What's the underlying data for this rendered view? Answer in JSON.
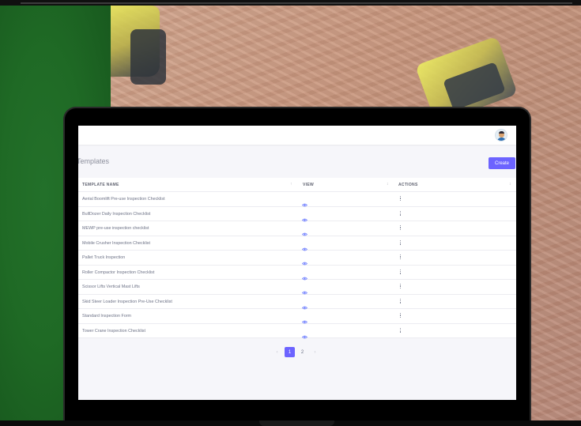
{
  "page": {
    "title": "Templates",
    "create_label": "Create"
  },
  "table": {
    "headers": {
      "name": "TEMPLATE NAME",
      "view": "VIEW",
      "actions": "ACTIONS"
    },
    "rows": [
      {
        "name": "Aerial Boomlift Pre-use Inspection Checklist"
      },
      {
        "name": "BullDozer Daily Inspection Checklist"
      },
      {
        "name": "MEWP pre-use inspection checklist"
      },
      {
        "name": "Mobile Crusher Inspection Checklist"
      },
      {
        "name": "Pallet Truck Inspection"
      },
      {
        "name": "Roller Compactor Inspection Checklist"
      },
      {
        "name": "Scissor Lifts Vertical Mast Lifts"
      },
      {
        "name": "Skid Steer Loader Inspection Pre-Use Checklist"
      },
      {
        "name": "Standard Inspection Form"
      },
      {
        "name": "Tower Crane Inspection Checklist"
      }
    ]
  },
  "pagination": {
    "prev": "‹",
    "pages": [
      "1",
      "2"
    ],
    "current": "1",
    "next": "›"
  },
  "icons": {
    "view": "eye-icon",
    "actions": "kebab-icon",
    "sort": "sort-icon",
    "user": "avatar"
  },
  "colors": {
    "accent": "#6c63ff",
    "background_green": "#1f6a25",
    "icon_blue": "#6c7cff"
  }
}
